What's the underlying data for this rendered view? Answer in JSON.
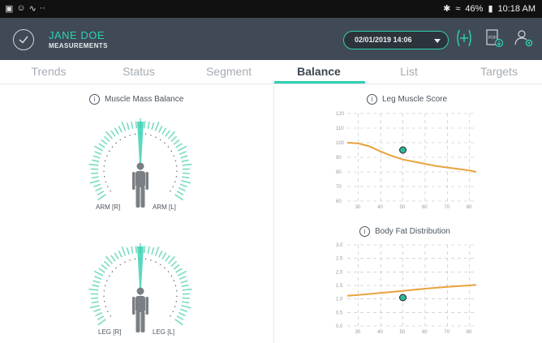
{
  "status_bar": {
    "left_icons": [
      "gallery-icon",
      "face-icon",
      "wifi-off-icon",
      "more-icon"
    ],
    "battery": "46%",
    "time": "10:18 AM"
  },
  "header": {
    "user_name": "JANE DOE",
    "subtitle": "MEASUREMENTS",
    "date": "02/01/2019 14:06"
  },
  "tabs": [
    {
      "label": "Trends"
    },
    {
      "label": "Status"
    },
    {
      "label": "Segment"
    },
    {
      "label": "Balance"
    },
    {
      "label": "List"
    },
    {
      "label": "Targets"
    }
  ],
  "active_tab": "Balance",
  "muscle_mass_balance": {
    "title": "Muscle Mass Balance",
    "arm_right": "ARM [R]",
    "arm_left": "ARM [L]",
    "leg_right": "LEG [R]",
    "leg_left": "LEG [L]"
  },
  "chart_data": [
    {
      "type": "line",
      "title": "Leg Muscle Score",
      "x_ticks": [
        "30",
        "40",
        "50",
        "60",
        "70",
        "80"
      ],
      "y_ticks": [
        "60",
        "70",
        "80",
        "90",
        "100",
        "110",
        "120"
      ],
      "xlim": [
        25,
        83
      ],
      "ylim": [
        60,
        120
      ],
      "series": [
        {
          "x": [
            25,
            30,
            35,
            40,
            45,
            50,
            55,
            60,
            65,
            70,
            75,
            80,
            83
          ],
          "values": [
            100,
            99.5,
            97.5,
            94,
            91,
            88.5,
            87,
            85.5,
            84,
            83,
            82,
            81,
            80
          ]
        }
      ],
      "point": {
        "x": 50,
        "y": 95
      },
      "colors": {
        "line": "#e8a33d",
        "point": "#2fb79a"
      }
    },
    {
      "type": "line",
      "title": "Body Fat Distribution",
      "x_ticks": [
        "30",
        "40",
        "50",
        "60",
        "70",
        "80"
      ],
      "y_ticks": [
        "0.0",
        "0.5",
        "1.0",
        "1.5",
        "2.0",
        "2.5",
        "3.0"
      ],
      "xlim": [
        25,
        83
      ],
      "ylim": [
        0,
        3
      ],
      "series": [
        {
          "x": [
            25,
            30,
            40,
            50,
            60,
            70,
            80,
            83
          ],
          "values": [
            1.12,
            1.15,
            1.22,
            1.3,
            1.38,
            1.45,
            1.5,
            1.52
          ]
        }
      ],
      "point": {
        "x": 50,
        "y": 1.05
      },
      "colors": {
        "line": "#e8a33d",
        "point": "#2fb79a"
      }
    }
  ],
  "colors": {
    "accent": "#2fd0b2",
    "header_bg": "#3f4a56",
    "gauge_green": "#79dcc3",
    "figure_gray": "#7a7f84"
  }
}
